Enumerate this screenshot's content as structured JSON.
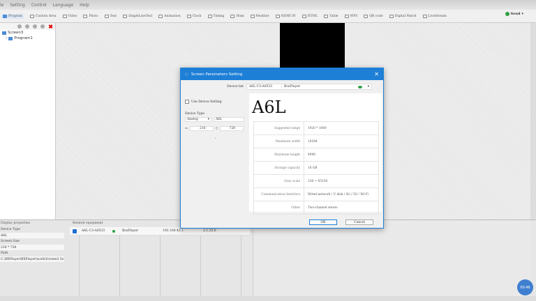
{
  "menu": [
    "le",
    "Setting",
    "Control",
    "Language",
    "Help"
  ],
  "toolbar": [
    "Program",
    "Custom Area",
    "Video",
    "Photo",
    "Text",
    "SingleLineText",
    "Animation",
    "Clock",
    "Timing",
    "Hum",
    "Weather",
    "HDMI IN",
    "HTML",
    "Table",
    "WPS",
    "QR code",
    "Digital Watch",
    "LiveStream"
  ],
  "send": "Send",
  "tree": {
    "screen": "Screen3",
    "program": "Program1"
  },
  "dialog": {
    "title": "Screen Parameters Setting",
    "device_list_label": "Device list",
    "device_id": "A6L-C3-A0533",
    "device_name": "BoxPlayer",
    "use_device_setting": "Use Device Setting",
    "device_type_label": "Device Type",
    "device_type_select": "Analog",
    "device_type_value": "A6L",
    "width": "216",
    "height": "728",
    "model": "A6L",
    "specs": [
      {
        "k": "Suggested range",
        "v": "1920 * 1080"
      },
      {
        "k": "Maximum width",
        "v": "16384"
      },
      {
        "k": "Maximum height",
        "v": "4096"
      },
      {
        "k": "Storage capacity",
        "v": "16 GB"
      },
      {
        "k": "Gray scale",
        "v": "256 ~ 65536"
      },
      {
        "k": "Communication Interface",
        "v": "Wired network / U disk / 4G / 5G / Wi-Fi"
      },
      {
        "k": "Other",
        "v": "Two-channel stereo"
      }
    ],
    "ok": "OK",
    "cancel": "Cancel"
  },
  "display_props": {
    "title": "Display properties",
    "device_type_label": "Device Type",
    "device_type": "A6L",
    "screen_size_label": "Screen Size",
    "screen_size": "216 * 728",
    "path_label": "Path",
    "path": "C:\\BXPlayer\\BXPlayer\\work\\Screen3 Scr"
  },
  "related": {
    "title": "Related equipment",
    "row": {
      "id": "A6L-C3-A0533",
      "name": "BoxPlayer",
      "ip": "192.168.42.1",
      "version": "2.1.25.0"
    }
  },
  "clock": "00:46",
  "colors": {
    "accent": "#1e7fd6",
    "online": "#2ea043"
  }
}
